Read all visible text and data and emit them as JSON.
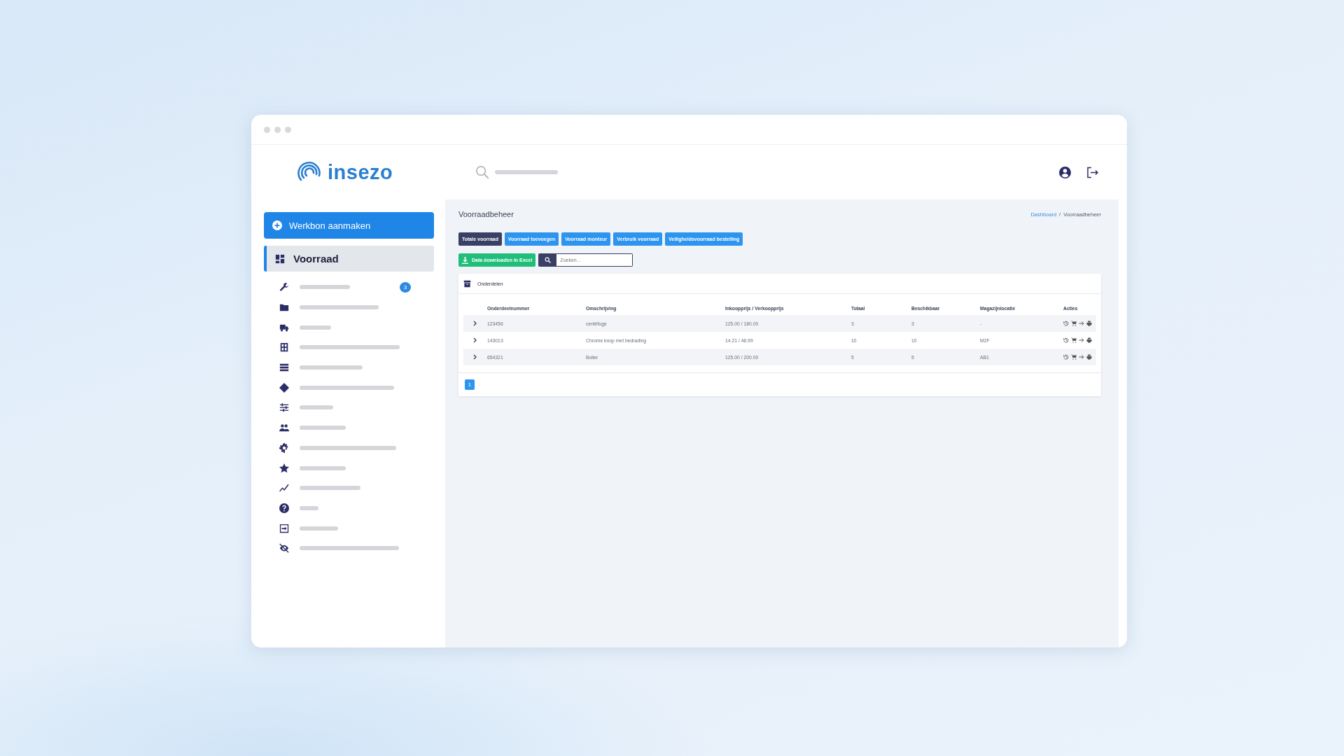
{
  "logo": {
    "name": "insezo"
  },
  "sidebar": {
    "create_button": "Werkbon aanmaken",
    "items": [
      {
        "label": "Voorraad",
        "selected": true
      },
      {
        "selected": false,
        "badge": "3"
      },
      {
        "selected": false
      },
      {
        "selected": false
      },
      {
        "selected": false
      },
      {
        "selected": false
      },
      {
        "selected": false
      },
      {
        "selected": false
      },
      {
        "selected": false
      },
      {
        "selected": false
      },
      {
        "selected": false
      },
      {
        "selected": false
      },
      {
        "selected": false
      },
      {
        "selected": false
      },
      {
        "selected": false
      }
    ]
  },
  "page": {
    "title": "Voorraadbeheer",
    "breadcrumb": [
      {
        "label": "Dashboard",
        "kind": "link"
      },
      {
        "label": "/",
        "kind": "separator"
      },
      {
        "label": "Voorraadbeheer",
        "kind": "current"
      }
    ]
  },
  "tabs": [
    {
      "label": "Totale voorraad",
      "selected": true
    },
    {
      "label": "Voorraad toevoegen",
      "selected": false
    },
    {
      "label": "Voorraad monteur",
      "selected": false
    },
    {
      "label": "Verbruik voorraad",
      "selected": false
    },
    {
      "label": "Veiligheidsvoorraad bestelling",
      "selected": false
    }
  ],
  "toolbar": {
    "download_button": "Data downloaden in Excel",
    "search": {
      "placeholder": "Zoeken..."
    }
  },
  "table": {
    "title": "Onderdelen",
    "columns": [
      "Onderdeelnummer",
      "Omschrijving",
      "Inkoopprijs / Verkoopprijs",
      "Totaal",
      "Beschikbaar",
      "Magazijnlocatie",
      "Acties"
    ],
    "rows": [
      {
        "cells": [
          "123456",
          "centrifuge",
          "125.00 / 180.00",
          "3",
          "3",
          "-"
        ]
      },
      {
        "cells": [
          "143013",
          "Chrome knop met bedrading",
          "14.21 / 46.99",
          "10",
          "10",
          "M2F"
        ]
      },
      {
        "cells": [
          "654321",
          "Boiler",
          "125.00 / 200.00",
          "5",
          "5",
          "AB1"
        ]
      }
    ]
  },
  "pagination": [
    {
      "label": "1",
      "selected": true
    }
  ]
}
